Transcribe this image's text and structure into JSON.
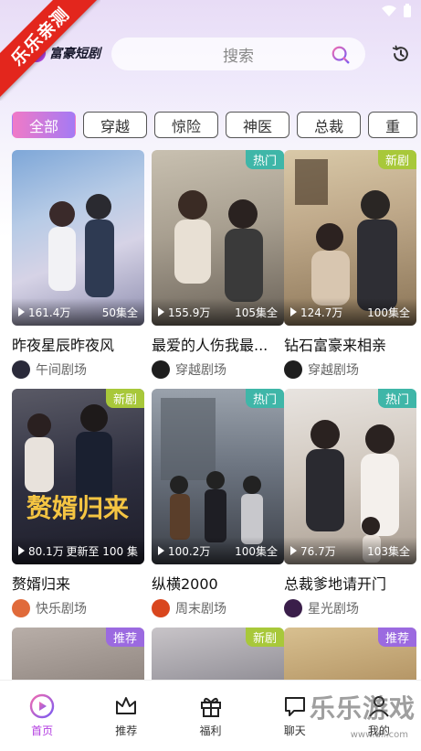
{
  "ribbon": "乐乐亲测",
  "brand": {
    "name": "富豪短剧"
  },
  "search": {
    "placeholder": "搜索"
  },
  "tabs": [
    "全部",
    "穿越",
    "惊险",
    "神医",
    "总裁",
    "重"
  ],
  "cards": [
    {
      "title": "昨夜星辰昨夜风",
      "views": "161.4万",
      "episodes": "50集全",
      "badge": "",
      "source": "午间剧场",
      "avatar_color": "#2a2a3a"
    },
    {
      "title": "最爱的人伤我最...",
      "views": "155.9万",
      "episodes": "105集全",
      "badge": "热门",
      "badge_color": "#3fb6a8",
      "source": "穿越剧场",
      "avatar_color": "#1e1e1e"
    },
    {
      "title": "钻石富豪来相亲",
      "views": "124.7万",
      "episodes": "100集全",
      "badge": "新剧",
      "badge_color": "#a8c83a",
      "source": "穿越剧场",
      "avatar_color": "#1e1e1e"
    },
    {
      "title": "赘婿归来",
      "views": "80.1万",
      "episodes": "更新至 100 集",
      "badge": "新剧",
      "badge_color": "#a8c83a",
      "source": "快乐剧场",
      "avatar_color": "#e06a3a"
    },
    {
      "title": "纵横2000",
      "views": "100.2万",
      "episodes": "100集全",
      "badge": "热门",
      "badge_color": "#3fb6a8",
      "source": "周末剧场",
      "avatar_color": "#d9461e"
    },
    {
      "title": "总裁爹地请开门",
      "views": "76.7万",
      "episodes": "103集全",
      "badge": "热门",
      "badge_color": "#3fb6a8",
      "source": "星光剧场",
      "avatar_color": "#3a1e4a"
    },
    {
      "title": "",
      "views": "",
      "episodes": "",
      "badge": "推荐",
      "badge_color": "#9b6ae0",
      "source": "",
      "avatar_color": ""
    },
    {
      "title": "",
      "views": "",
      "episodes": "",
      "badge": "新剧",
      "badge_color": "#a8c83a",
      "source": "",
      "avatar_color": ""
    },
    {
      "title": "",
      "views": "",
      "episodes": "",
      "badge": "推荐",
      "badge_color": "#9b6ae0",
      "source": "",
      "avatar_color": ""
    }
  ],
  "nav": [
    {
      "label": "首页",
      "icon": "play-circle-icon",
      "active": true
    },
    {
      "label": "推荐",
      "icon": "crown-icon"
    },
    {
      "label": "福利",
      "icon": "gift-icon"
    },
    {
      "label": "聊天",
      "icon": "chat-icon"
    },
    {
      "label": "我的",
      "icon": "user-icon"
    }
  ],
  "watermark": {
    "text": "乐乐游戏",
    "url": "www.dll.com"
  },
  "colors": {
    "accent": "#b23be0",
    "ribbon": "#e3261d"
  }
}
